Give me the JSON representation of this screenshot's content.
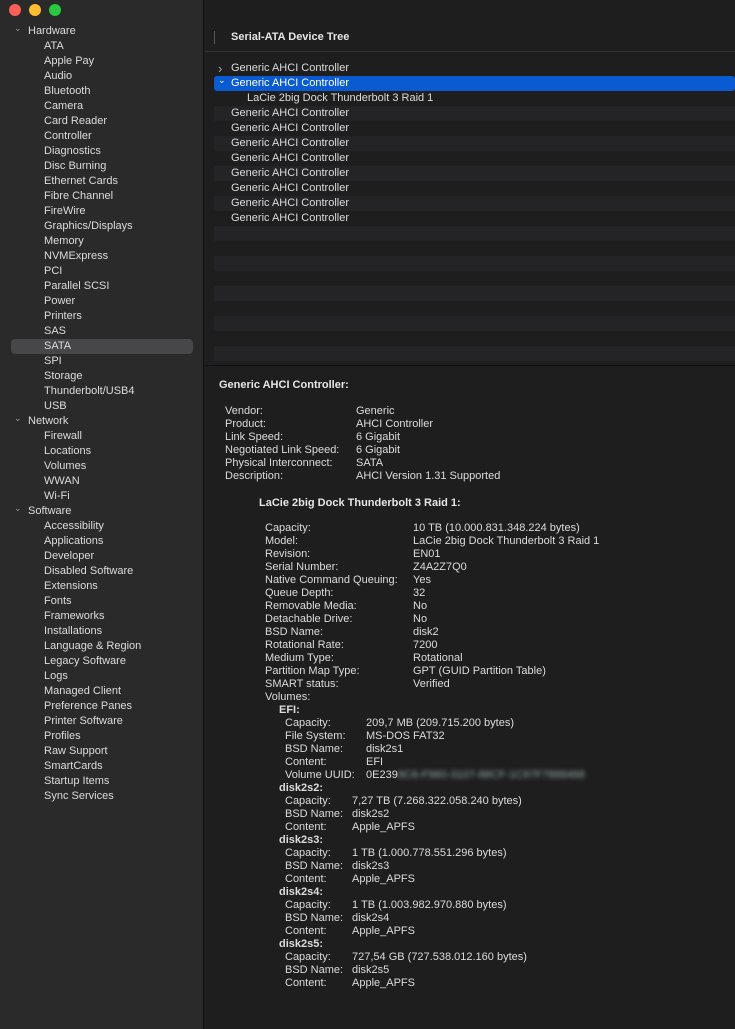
{
  "sidebar": {
    "groups": [
      {
        "label": "Hardware",
        "items": [
          "ATA",
          "Apple Pay",
          "Audio",
          "Bluetooth",
          "Camera",
          "Card Reader",
          "Controller",
          "Diagnostics",
          "Disc Burning",
          "Ethernet Cards",
          "Fibre Channel",
          "FireWire",
          "Graphics/Displays",
          "Memory",
          "NVMExpress",
          "PCI",
          "Parallel SCSI",
          "Power",
          "Printers",
          "SAS",
          "SATA",
          "SPI",
          "Storage",
          "Thunderbolt/USB4",
          "USB"
        ]
      },
      {
        "label": "Network",
        "items": [
          "Firewall",
          "Locations",
          "Volumes",
          "WWAN",
          "Wi-Fi"
        ]
      },
      {
        "label": "Software",
        "items": [
          "Accessibility",
          "Applications",
          "Developer",
          "Disabled Software",
          "Extensions",
          "Fonts",
          "Frameworks",
          "Installations",
          "Language & Region",
          "Legacy Software",
          "Logs",
          "Managed Client",
          "Preference Panes",
          "Printer Software",
          "Profiles",
          "Raw Support",
          "SmartCards",
          "Startup Items",
          "Sync Services"
        ]
      }
    ],
    "selected": "SATA"
  },
  "header": {
    "title": "Serial-ATA Device Tree"
  },
  "device_list": {
    "controller_label": "Generic AHCI Controller",
    "child_label": "LaCie   2big Dock Thunderbolt 3   Raid 1"
  },
  "details": {
    "controller_title": "Generic AHCI Controller:",
    "controller_props": [
      {
        "k": "Vendor:",
        "v": "Generic"
      },
      {
        "k": "Product:",
        "v": "AHCI Controller"
      },
      {
        "k": "Link Speed:",
        "v": "6 Gigabit"
      },
      {
        "k": "Negotiated Link Speed:",
        "v": "6 Gigabit"
      },
      {
        "k": "Physical Interconnect:",
        "v": "SATA"
      },
      {
        "k": "Description:",
        "v": "AHCI Version 1.31 Supported"
      }
    ],
    "drive_title": "LaCie   2big Dock Thunderbolt 3   Raid 1:",
    "drive_props": [
      {
        "k": "Capacity:",
        "v": "10 TB (10.000.831.348.224 bytes)"
      },
      {
        "k": "Model:",
        "v": "LaCie   2big Dock Thunderbolt 3   Raid 1"
      },
      {
        "k": "Revision:",
        "v": "EN01"
      },
      {
        "k": "Serial Number:",
        "v": "Z4A2Z7Q0"
      },
      {
        "k": "Native Command Queuing:",
        "v": "Yes"
      },
      {
        "k": "Queue Depth:",
        "v": "32"
      },
      {
        "k": "Removable Media:",
        "v": "No"
      },
      {
        "k": "Detachable Drive:",
        "v": "No"
      },
      {
        "k": "BSD Name:",
        "v": "disk2"
      },
      {
        "k": "Rotational Rate:",
        "v": "7200"
      },
      {
        "k": "Medium Type:",
        "v": "Rotational"
      },
      {
        "k": "Partition Map Type:",
        "v": "GPT (GUID Partition Table)"
      },
      {
        "k": "SMART status:",
        "v": "Verified"
      },
      {
        "k": "Volumes:",
        "v": ""
      }
    ],
    "volumes": [
      {
        "name": "EFI:",
        "props": [
          {
            "k": "Capacity:",
            "v": "209,7 MB (209.715.200 bytes)"
          },
          {
            "k": "File System:",
            "v": "MS-DOS FAT32"
          },
          {
            "k": "BSD Name:",
            "v": "disk2s1"
          },
          {
            "k": "Content:",
            "v": "EFI"
          },
          {
            "k": "Volume UUID:",
            "v": "0E239",
            "blurred": "8C6-F960-3107-88CF-1C97F7888468"
          }
        ]
      },
      {
        "name": "disk2s2:",
        "props": [
          {
            "k": "Capacity:",
            "v": "7,27 TB (7.268.322.058.240 bytes)"
          },
          {
            "k": "BSD Name:",
            "v": "disk2s2"
          },
          {
            "k": "Content:",
            "v": "Apple_APFS"
          }
        ]
      },
      {
        "name": "disk2s3:",
        "props": [
          {
            "k": "Capacity:",
            "v": "1 TB (1.000.778.551.296 bytes)"
          },
          {
            "k": "BSD Name:",
            "v": "disk2s3"
          },
          {
            "k": "Content:",
            "v": "Apple_APFS"
          }
        ]
      },
      {
        "name": "disk2s4:",
        "props": [
          {
            "k": "Capacity:",
            "v": "1 TB (1.003.982.970.880 bytes)"
          },
          {
            "k": "BSD Name:",
            "v": "disk2s4"
          },
          {
            "k": "Content:",
            "v": "Apple_APFS"
          }
        ]
      },
      {
        "name": "disk2s5:",
        "props": [
          {
            "k": "Capacity:",
            "v": "727,54 GB (727.538.012.160 bytes)"
          },
          {
            "k": "BSD Name:",
            "v": "disk2s5"
          },
          {
            "k": "Content:",
            "v": "Apple_APFS"
          }
        ]
      }
    ]
  },
  "colors": {
    "selection": "#0a5ad1",
    "sidebar_selected": "#47474a"
  }
}
